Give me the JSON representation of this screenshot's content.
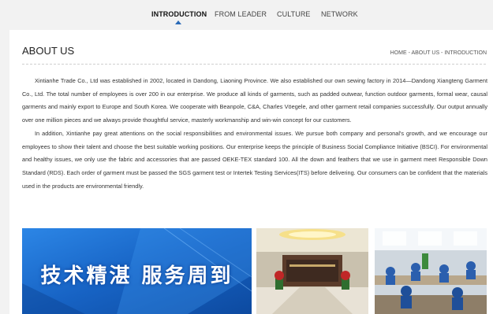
{
  "nav": {
    "tabs": [
      "INTRODUCTION",
      "FROM LEADER",
      "CULTURE",
      "NETWORK"
    ],
    "active": "INTRODUCTION"
  },
  "page": {
    "title": "ABOUT US",
    "breadcrumb": "HOME - ABOUT US - INTRODUCTION"
  },
  "content": {
    "paragraph1": "Xintianhe Trade Co., Ltd was established in 2002, located in Dandong, Liaoning Province. We also established our own sewing factory in 2014—Dandong Xiangteng Garment Co., Ltd. The total number of employees is over 200 in our enterprise. We produce all kinds of garments, such as padded outwear, function outdoor garments, formal wear, causal garments and mainly export to Europe and South Korea. We cooperate with Beanpole, C&A, Charles Vöegele, and other garment retail companies successfully. Our output annually over one million pieces and we always provide thoughtful service, masterly workmanship and win-win concept for our customers.",
    "paragraph2": "In addition, Xintianhe pay great attentions on the social responsibilities and environmental issues. We pursue both company and personal's growth, and we encourage our employees to show their talent and choose the best suitable working positions. Our enterprise keeps the principle of Business Social Compliance Initiative (BSCI). For environmental and healthy issues, we only use the fabric and accessories that are passed OEKE-TEX standard 100. All the down and feathers that we use in garment meet Responsible Down Standard (RDS). Each order of garment must be passed the SGS garment test or Intertek Testing Services(ITS) before delivering. Our consumers can be confident that the materials used in the products are environmental friendly."
  },
  "banner": {
    "text": "技术精湛 服务周到"
  },
  "colors": {
    "accent": "#2a6ab7",
    "banner_blue": "#1f6fd1",
    "background": "#f2f2f2"
  }
}
